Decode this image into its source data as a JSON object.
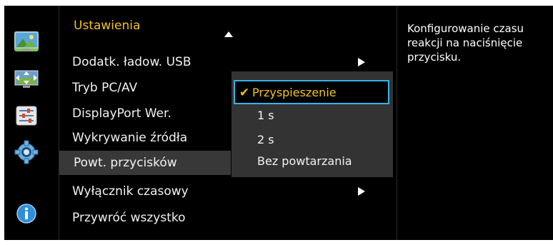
{
  "menu": {
    "title": "Ustawienia",
    "items": [
      {
        "label": "Dodatk. ładow. USB",
        "has_submenu": true
      },
      {
        "label": "Tryb PC/AV",
        "has_submenu": false
      },
      {
        "label": "DisplayPort Wer.",
        "has_submenu": false
      },
      {
        "label": "Wykrywanie źródła",
        "has_submenu": false
      },
      {
        "label": "Powt. przycisków",
        "has_submenu": false,
        "selected": true
      },
      {
        "label": "Wyłącznik czasowy",
        "has_submenu": true
      },
      {
        "label": "Przywróć wszystko",
        "has_submenu": false
      }
    ]
  },
  "submenu": {
    "options": [
      {
        "label": "Przyspieszenie",
        "checked": true
      },
      {
        "label": "1 s"
      },
      {
        "label": "2 s"
      },
      {
        "label": "Bez powtarzania"
      }
    ]
  },
  "help": {
    "text": "Konfigurowanie czasu reakcji na naciśnięcie przycisku."
  },
  "icons": [
    "picture-icon",
    "position-icon",
    "settings-sliders-icon",
    "gear-icon",
    "info-icon"
  ],
  "colors": {
    "accent": "#f3c21b",
    "focus_border": "#35b4e8",
    "selected_row": "#383838",
    "submenu_bg": "#333333"
  }
}
